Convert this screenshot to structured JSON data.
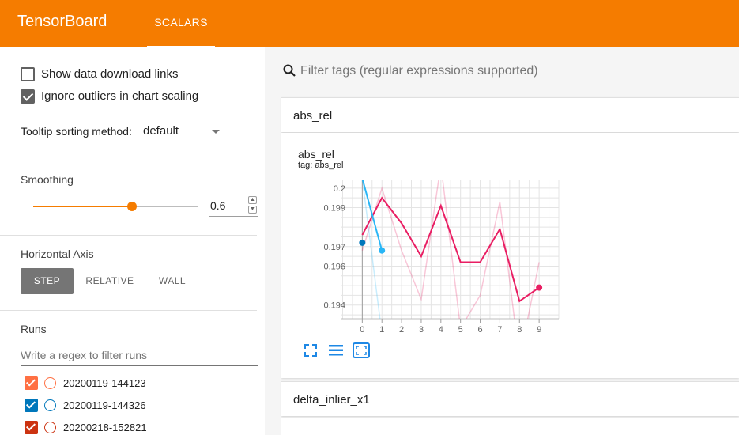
{
  "app": {
    "title": "TensorBoard",
    "active_tab": "SCALARS",
    "accent": "#f57c00"
  },
  "sidebar": {
    "show_download_links": {
      "label": "Show data download links",
      "checked": false
    },
    "ignore_outliers": {
      "label": "Ignore outliers in chart scaling",
      "checked": true
    },
    "tooltip_sorting": {
      "label": "Tooltip sorting method:",
      "value": "default"
    },
    "smoothing": {
      "title": "Smoothing",
      "value": "0.6",
      "fraction": 0.6
    },
    "horizontal_axis": {
      "title": "Horizontal Axis",
      "options": [
        "STEP",
        "RELATIVE",
        "WALL"
      ],
      "selected": "STEP"
    },
    "runs": {
      "title": "Runs",
      "placeholder": "Write a regex to filter runs",
      "items": [
        {
          "name": "20200119-144123",
          "color": "#ff7043"
        },
        {
          "name": "20200119-144326",
          "color": "#0077bb"
        },
        {
          "name": "20200218-152821",
          "color": "#cc3311"
        }
      ]
    }
  },
  "main": {
    "filter_placeholder": "Filter tags (regular expressions supported)",
    "categories": [
      {
        "label": "abs_rel"
      },
      {
        "label": "delta_inlier_x1"
      }
    ],
    "card": {
      "title": "abs_rel",
      "tag": "tag: abs_rel",
      "next_title": "delta_inlier_x1"
    }
  },
  "chart_data": {
    "type": "line",
    "title": "abs_rel",
    "xlabel": "",
    "ylabel": "",
    "x_ticks": [
      0,
      1,
      2,
      3,
      4,
      5,
      6,
      7,
      8,
      9
    ],
    "y_ticks": [
      0.194,
      0.196,
      0.197,
      0.199,
      0.2
    ],
    "xlim": [
      -1.1,
      10
    ],
    "ylim": [
      0.1933,
      0.2004
    ],
    "series": [
      {
        "color": "#e91e63",
        "x": [
          0,
          1,
          2,
          3,
          4,
          5,
          6,
          7,
          8,
          9
        ],
        "smoothed": [
          0.1976,
          0.1995,
          0.1982,
          0.1965,
          0.1991,
          0.1962,
          0.1962,
          0.1979,
          0.1942,
          0.1949
        ],
        "raw": [
          0.1968,
          0.2,
          0.1968,
          0.1943,
          0.2012,
          0.1928,
          0.1945,
          0.1993,
          0.1912,
          0.1962
        ]
      },
      {
        "color": "#29b6f6",
        "x": [
          0,
          1
        ],
        "smoothed": [
          0.2005,
          0.1968
        ],
        "raw": [
          0.2005,
          0.1925
        ]
      },
      {
        "color": "#0077bb",
        "x": [
          0
        ],
        "smoothed": [
          0.1972
        ],
        "raw": [
          0.1972
        ]
      }
    ],
    "grid": true
  }
}
